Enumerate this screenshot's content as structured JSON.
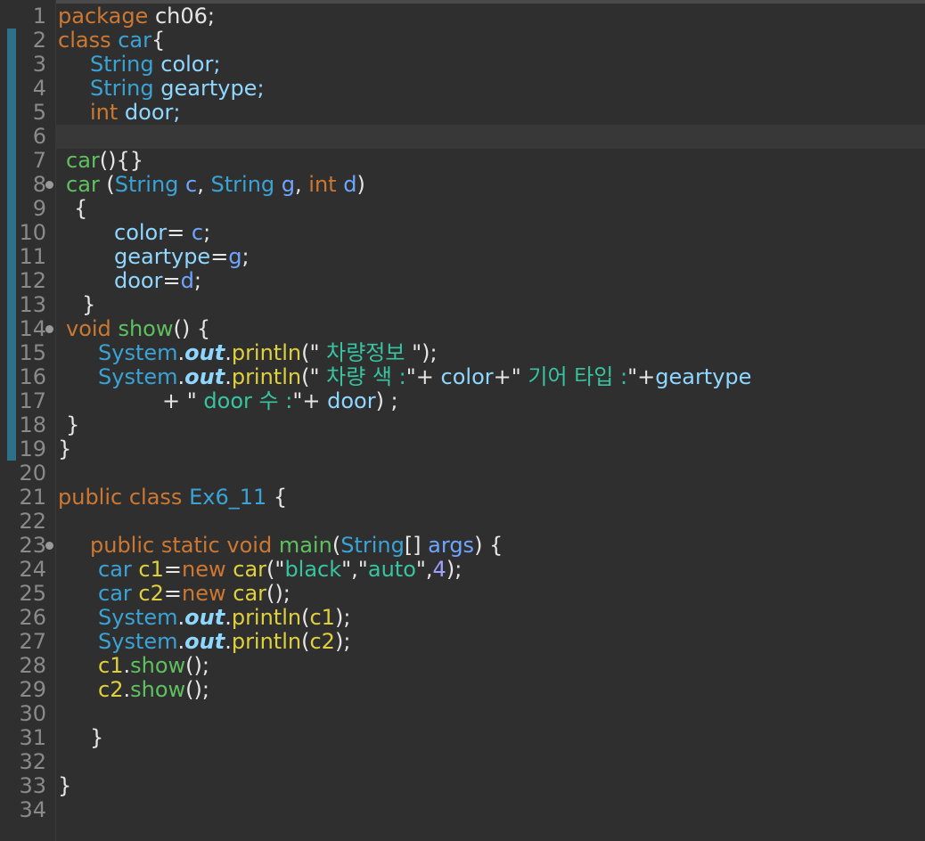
{
  "colors": {
    "keyword": "#cc7832",
    "type": "#3aa3d6",
    "field": "#8fd7ff",
    "param": "#6ea6ff",
    "method": "#5ec05e",
    "call": "#dfd03e",
    "string": "#38c4a0",
    "plain": "#e6e6e6",
    "number": "#a0a0ff"
  },
  "editor": {
    "line_numbers": [
      "1",
      "2",
      "3",
      "4",
      "5",
      "6",
      "7",
      "8",
      "9",
      "10",
      "11",
      "12",
      "13",
      "14",
      "15",
      "16",
      "17",
      "18",
      "19",
      "20",
      "21",
      "22",
      "23",
      "24",
      "25",
      "26",
      "27",
      "28",
      "29",
      "30",
      "31",
      "32",
      "33",
      "34"
    ],
    "fold_markers": [
      "8",
      "14",
      "23"
    ],
    "lines": [
      {
        "indent": 0,
        "tokens": [
          [
            "package",
            "keyword"
          ],
          [
            " ch06;",
            "plain"
          ]
        ]
      },
      {
        "indent": 0,
        "tokens": [
          [
            "class",
            "keyword"
          ],
          [
            " ",
            "plain"
          ],
          [
            "car",
            "type"
          ],
          [
            "{",
            "plain"
          ]
        ]
      },
      {
        "indent": 36,
        "tokens": [
          [
            "String",
            "type"
          ],
          [
            " color;",
            "field"
          ]
        ]
      },
      {
        "indent": 36,
        "tokens": [
          [
            "String",
            "type"
          ],
          [
            " geartype;",
            "field"
          ]
        ]
      },
      {
        "indent": 36,
        "tokens": [
          [
            "int",
            "keyword"
          ],
          [
            " door;",
            "field"
          ]
        ]
      },
      {
        "indent": 0,
        "tokens": []
      },
      {
        "indent": 9,
        "tokens": [
          [
            "car",
            "method"
          ],
          [
            "(){}",
            "plain"
          ]
        ]
      },
      {
        "indent": 9,
        "tokens": [
          [
            "car",
            "method"
          ],
          [
            " (",
            "plain"
          ],
          [
            "String",
            "type"
          ],
          [
            " ",
            "plain"
          ],
          [
            "c",
            "param"
          ],
          [
            ", ",
            "plain"
          ],
          [
            "String",
            "type"
          ],
          [
            " ",
            "plain"
          ],
          [
            "g",
            "param"
          ],
          [
            ", ",
            "plain"
          ],
          [
            "int",
            "keyword"
          ],
          [
            " ",
            "plain"
          ],
          [
            "d",
            "param"
          ],
          [
            ")",
            "plain"
          ]
        ]
      },
      {
        "indent": 18,
        "tokens": [
          [
            "{",
            "plain"
          ]
        ]
      },
      {
        "indent": 63,
        "tokens": [
          [
            "color",
            "field"
          ],
          [
            "= ",
            "plain"
          ],
          [
            "c",
            "param"
          ],
          [
            ";",
            "plain"
          ]
        ]
      },
      {
        "indent": 63,
        "tokens": [
          [
            "geartype",
            "field"
          ],
          [
            "=",
            "plain"
          ],
          [
            "g",
            "param"
          ],
          [
            ";",
            "plain"
          ]
        ]
      },
      {
        "indent": 63,
        "tokens": [
          [
            "door",
            "field"
          ],
          [
            "=",
            "plain"
          ],
          [
            "d",
            "param"
          ],
          [
            ";",
            "plain"
          ]
        ]
      },
      {
        "indent": 27,
        "tokens": [
          [
            "}",
            "plain"
          ]
        ]
      },
      {
        "indent": 9,
        "tokens": [
          [
            "void",
            "keyword"
          ],
          [
            " ",
            "plain"
          ],
          [
            "show",
            "method"
          ],
          [
            "() {",
            "plain"
          ]
        ]
      },
      {
        "indent": 45,
        "tokens": [
          [
            "System",
            "type"
          ],
          [
            ".",
            "plain"
          ],
          [
            "out",
            "field-it"
          ],
          [
            ".",
            "plain"
          ],
          [
            "println",
            "call"
          ],
          [
            "(\"",
            "plain"
          ],
          [
            " 차량정보 ",
            "string"
          ],
          [
            "\");",
            "plain"
          ]
        ]
      },
      {
        "indent": 45,
        "tokens": [
          [
            "System",
            "type"
          ],
          [
            ".",
            "plain"
          ],
          [
            "out",
            "field-it"
          ],
          [
            ".",
            "plain"
          ],
          [
            "println",
            "call"
          ],
          [
            "(\"",
            "plain"
          ],
          [
            " 차량 색 :",
            "string"
          ],
          [
            "\"+ ",
            "plain"
          ],
          [
            "color",
            "field"
          ],
          [
            "+\"",
            "plain"
          ],
          [
            " 기어 타입 :",
            "string"
          ],
          [
            "\"+",
            "plain"
          ],
          [
            "geartype",
            "field"
          ]
        ]
      },
      {
        "indent": 117,
        "tokens": [
          [
            "+ \"",
            "plain"
          ],
          [
            " door 수 :",
            "string"
          ],
          [
            "\"+ ",
            "plain"
          ],
          [
            "door",
            "field"
          ],
          [
            ") ;",
            "plain"
          ]
        ]
      },
      {
        "indent": 9,
        "tokens": [
          [
            "}",
            "plain"
          ]
        ]
      },
      {
        "indent": 0,
        "tokens": [
          [
            "}",
            "plain"
          ]
        ]
      },
      {
        "indent": 0,
        "tokens": []
      },
      {
        "indent": 0,
        "tokens": [
          [
            "public",
            "keyword"
          ],
          [
            " ",
            "plain"
          ],
          [
            "class",
            "keyword"
          ],
          [
            " ",
            "plain"
          ],
          [
            "Ex6_11",
            "type"
          ],
          [
            " {",
            "plain"
          ]
        ]
      },
      {
        "indent": 0,
        "tokens": []
      },
      {
        "indent": 36,
        "tokens": [
          [
            "public",
            "keyword"
          ],
          [
            " ",
            "plain"
          ],
          [
            "static",
            "keyword"
          ],
          [
            " ",
            "plain"
          ],
          [
            "void",
            "keyword"
          ],
          [
            " ",
            "plain"
          ],
          [
            "main",
            "method"
          ],
          [
            "(",
            "plain"
          ],
          [
            "String",
            "type"
          ],
          [
            "[] ",
            "plain"
          ],
          [
            "args",
            "param"
          ],
          [
            ") {",
            "plain"
          ]
        ]
      },
      {
        "indent": 45,
        "tokens": [
          [
            "car",
            "type"
          ],
          [
            " ",
            "plain"
          ],
          [
            "c1",
            "call"
          ],
          [
            "=",
            "plain"
          ],
          [
            "new",
            "keyword"
          ],
          [
            " ",
            "plain"
          ],
          [
            "car",
            "call"
          ],
          [
            "(\"",
            "plain"
          ],
          [
            "black",
            "string"
          ],
          [
            "\",\"",
            "plain"
          ],
          [
            "auto",
            "string"
          ],
          [
            "\",",
            "plain"
          ],
          [
            "4",
            "number"
          ],
          [
            ");",
            "plain"
          ]
        ]
      },
      {
        "indent": 45,
        "tokens": [
          [
            "car",
            "type"
          ],
          [
            " ",
            "plain"
          ],
          [
            "c2",
            "call"
          ],
          [
            "=",
            "plain"
          ],
          [
            "new",
            "keyword"
          ],
          [
            " ",
            "plain"
          ],
          [
            "car",
            "call"
          ],
          [
            "();",
            "plain"
          ]
        ]
      },
      {
        "indent": 45,
        "tokens": [
          [
            "System",
            "type"
          ],
          [
            ".",
            "plain"
          ],
          [
            "out",
            "field-it"
          ],
          [
            ".",
            "plain"
          ],
          [
            "println",
            "call"
          ],
          [
            "(",
            "plain"
          ],
          [
            "c1",
            "call"
          ],
          [
            ");",
            "plain"
          ]
        ]
      },
      {
        "indent": 45,
        "tokens": [
          [
            "System",
            "type"
          ],
          [
            ".",
            "plain"
          ],
          [
            "out",
            "field-it"
          ],
          [
            ".",
            "plain"
          ],
          [
            "println",
            "call"
          ],
          [
            "(",
            "plain"
          ],
          [
            "c2",
            "call"
          ],
          [
            ");",
            "plain"
          ]
        ]
      },
      {
        "indent": 45,
        "tokens": [
          [
            "c1",
            "call"
          ],
          [
            ".",
            "plain"
          ],
          [
            "show",
            "method"
          ],
          [
            "();",
            "plain"
          ]
        ]
      },
      {
        "indent": 45,
        "tokens": [
          [
            "c2",
            "call"
          ],
          [
            ".",
            "plain"
          ],
          [
            "show",
            "method"
          ],
          [
            "();",
            "plain"
          ]
        ]
      },
      {
        "indent": 0,
        "tokens": []
      },
      {
        "indent": 36,
        "tokens": [
          [
            "}",
            "plain"
          ]
        ]
      },
      {
        "indent": 0,
        "tokens": []
      },
      {
        "indent": 0,
        "tokens": [
          [
            "}",
            "plain"
          ]
        ]
      },
      {
        "indent": 0,
        "tokens": []
      }
    ]
  }
}
